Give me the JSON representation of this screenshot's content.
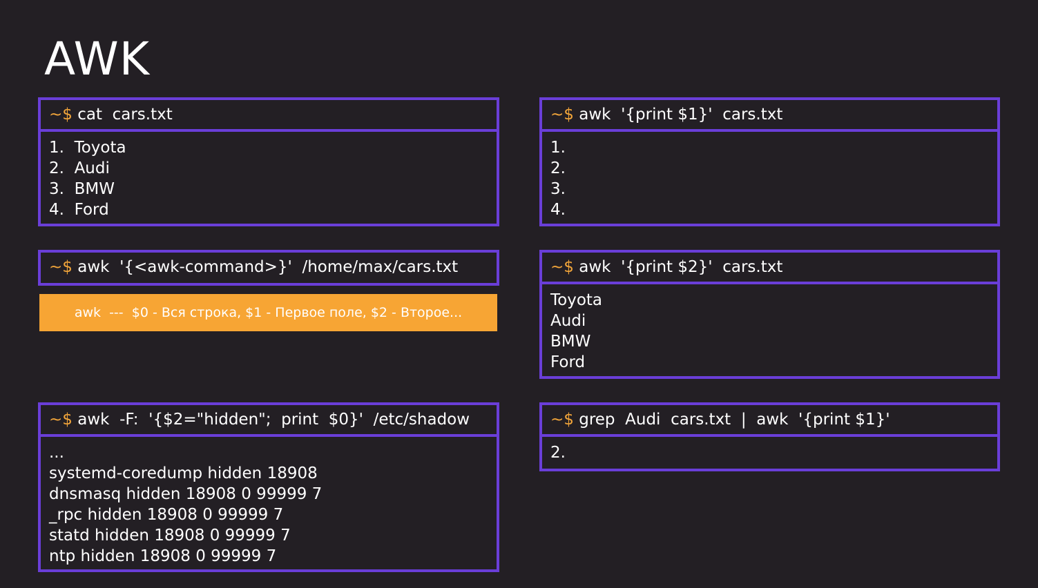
{
  "slide": {
    "title": "AWK"
  },
  "prompt": "~$",
  "panels": {
    "cat": {
      "command": "cat  cars.txt",
      "output": [
        "1.  Toyota",
        "2.  Audi",
        "3.  BMW",
        "4.  Ford"
      ]
    },
    "print1": {
      "command": "awk  '{print $1}'  cars.txt",
      "output": [
        "1.",
        "2.",
        "3.",
        "4."
      ]
    },
    "syntax": {
      "command": "awk  '{<awk-command>}'  /home/max/cars.txt"
    },
    "note": {
      "text": "awk  ---  $0 - Вся строка, $1 - Первое поле, $2 - Второе..."
    },
    "print2": {
      "command": "awk  '{print $2}'  cars.txt",
      "output": [
        "Toyota",
        "Audi",
        "BMW",
        "Ford"
      ]
    },
    "shadow": {
      "command": "awk  -F:  '{$2=\"hidden\";  print  $0}'  /etc/shadow",
      "output": [
        "...",
        "systemd-coredump hidden 18908",
        "dnsmasq hidden 18908 0 99999 7",
        "_rpc hidden 18908 0 99999 7",
        "statd hidden 18908 0 99999 7",
        "ntp hidden 18908 0 99999 7"
      ]
    },
    "grep": {
      "command": "grep  Audi  cars.txt  |  awk  '{print $1}'",
      "output": [
        "2."
      ]
    }
  },
  "colors": {
    "background": "#231f24",
    "border": "#6a3ed8",
    "prompt": "#f2a53a",
    "note": "#f7a534"
  }
}
